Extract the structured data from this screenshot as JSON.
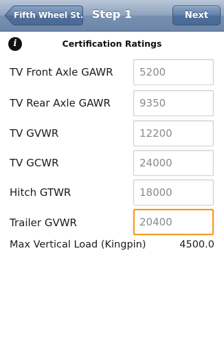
{
  "navbar": {
    "back_label": "Fifth Wheel St.",
    "title": "Step 1",
    "next_label": "Next"
  },
  "section": {
    "info_icon": "info-icon",
    "title": "Certification Ratings"
  },
  "fields": [
    {
      "label": "TV Front Axle GAWR",
      "value": "5200"
    },
    {
      "label": "TV Rear Axle GAWR",
      "value": "9350"
    },
    {
      "label": "TV GVWR",
      "value": "12200"
    },
    {
      "label": "TV GCWR",
      "value": "24000"
    },
    {
      "label": "Hitch GTWR",
      "value": "18000"
    },
    {
      "label": "Trailer GVWR",
      "value": "20400"
    }
  ],
  "result": {
    "label": "Max Vertical Load (Kingpin)",
    "value": "4500.0"
  },
  "colors": {
    "navbar": "#7890b0",
    "focus_border": "#f39a1f",
    "field_text": "#8a8a8a"
  }
}
